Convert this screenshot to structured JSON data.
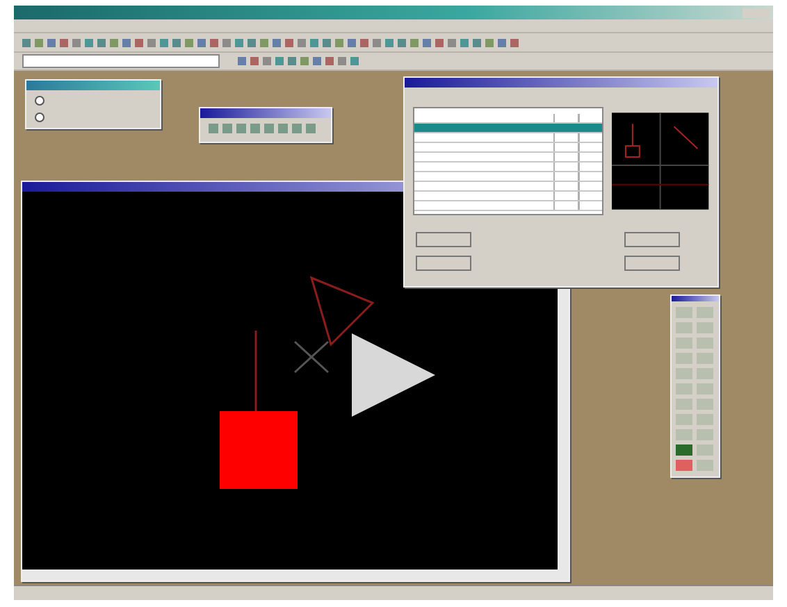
{
  "windows": [
    {
      "kind": "panel"
    },
    {
      "kind": "palette"
    },
    {
      "kind": "drawing",
      "play_overlay": true
    },
    {
      "kind": "library",
      "rows": [
        {
          "selected": false
        },
        {
          "selected": true
        },
        {
          "selected": false
        },
        {
          "selected": false
        },
        {
          "selected": false
        },
        {
          "selected": false
        },
        {
          "selected": false
        },
        {
          "selected": false
        },
        {
          "selected": false
        },
        {
          "selected": false
        }
      ]
    },
    {
      "kind": "toolbox"
    }
  ]
}
